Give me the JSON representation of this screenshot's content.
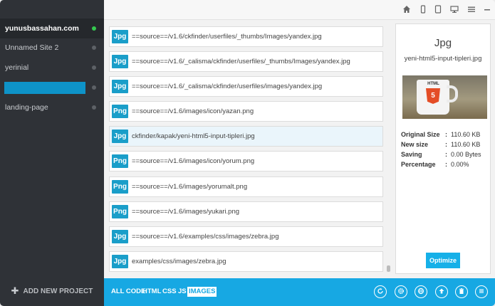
{
  "sidebar": {
    "sites": [
      {
        "name": "yunusbassahan.com",
        "active": true
      },
      {
        "name": "Unnamed Site 2",
        "active": false
      },
      {
        "name": "yerinial",
        "active": false
      },
      {
        "name": "",
        "active": false
      },
      {
        "name": "landing-page",
        "active": false
      }
    ],
    "add_project_label": "ADD NEW PROJECT"
  },
  "topbar": {
    "icons": [
      "home-icon",
      "phone-icon",
      "tablet-icon",
      "monitor-icon",
      "menu-icon",
      "minimize-icon",
      "close-icon"
    ]
  },
  "files": [
    {
      "type": "Jpg",
      "path": "==source==/v1.6/ckfinder/userfiles/_thumbs/Images/yandex.jpg",
      "selected": false
    },
    {
      "type": "Jpg",
      "path": "==source==/v1.6/_calisma/ckfinder/userfiles/_thumbs/Images/yandex.jpg",
      "selected": false
    },
    {
      "type": "Jpg",
      "path": "==source==/v1.6/_calisma/ckfinder/userfiles/images/yandex.jpg",
      "selected": false
    },
    {
      "type": "Png",
      "path": "==source==/v1.6/images/icon/yazan.png",
      "selected": false
    },
    {
      "type": "Jpg",
      "path": "ckfinder/kapak/yeni-html5-input-tipleri.jpg",
      "selected": true
    },
    {
      "type": "Png",
      "path": "==source==/v1.6/images/icon/yorum.png",
      "selected": false
    },
    {
      "type": "Png",
      "path": "==source==/v1.6/images/yorumalt.png",
      "selected": false
    },
    {
      "type": "Png",
      "path": "==source==/v1.6/images/yukari.png",
      "selected": false
    },
    {
      "type": "Jpg",
      "path": "==source==/v1.6/examples/css/images/zebra.jpg",
      "selected": false
    },
    {
      "type": "Jpg",
      "path": "examples/css/images/zebra.jpg",
      "selected": false
    }
  ],
  "detail": {
    "type": "Jpg",
    "filename": "yeni-html5-input-tipleri.jpg",
    "preview_text": "HTML",
    "preview_badge": "5",
    "stats": [
      {
        "label": "Original Size",
        "sep": ":",
        "value": "110.60 KB"
      },
      {
        "label": "New size",
        "sep": ":",
        "value": "110.60 KB"
      },
      {
        "label": "Saving",
        "sep": ":",
        "value": "0.00 Bytes"
      },
      {
        "label": "Percentage",
        "sep": ":",
        "value": "0.00%"
      }
    ],
    "optimize_label": "Optimize"
  },
  "bottombar": {
    "filters": [
      {
        "label": "ALL CODE",
        "active": false
      },
      {
        "label": "HTML",
        "active": false
      },
      {
        "label": "CSS",
        "active": false
      },
      {
        "label": "JS",
        "active": false
      },
      {
        "label": "IMAGES",
        "active": true
      }
    ],
    "actions": [
      "refresh-icon",
      "settings-icon",
      "globe-icon",
      "upload-icon",
      "trash-icon",
      "list-icon"
    ]
  }
}
